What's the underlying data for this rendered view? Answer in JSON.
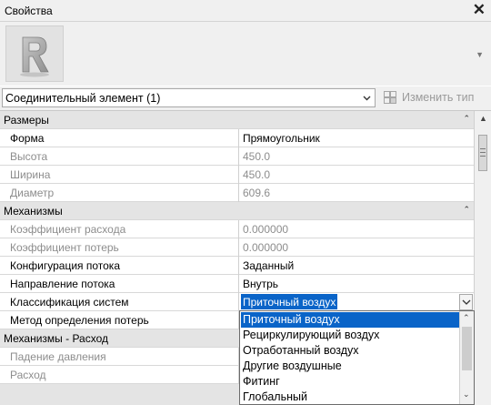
{
  "titlebar": {
    "title": "Свойства",
    "close_icon": "close-icon"
  },
  "preview": {
    "logo_letter": "R",
    "scroll_icon": "scroll-down-icon"
  },
  "type_selector": {
    "value": "Соединительный элемент (1)",
    "edit_type_label": "Изменить тип"
  },
  "groups": {
    "sizes": "Размеры",
    "mechanics": "Механизмы",
    "mechanics_flow": "Механизмы - Расход"
  },
  "params": {
    "shape": {
      "name": "Форма",
      "value": "Прямоугольник"
    },
    "height": {
      "name": "Высота",
      "value": "450.0"
    },
    "width": {
      "name": "Ширина",
      "value": "450.0"
    },
    "diameter": {
      "name": "Диаметр",
      "value": "609.6"
    },
    "flow_coef": {
      "name": "Коэффициент расхода",
      "value": "0.000000"
    },
    "loss_coef": {
      "name": "Коэффициент потерь",
      "value": "0.000000"
    },
    "flow_config": {
      "name": "Конфигурация потока",
      "value": "Заданный"
    },
    "flow_direction": {
      "name": "Направление потока",
      "value": "Внутрь"
    },
    "system_class": {
      "name": "Классификация систем",
      "value": "Приточный воздух"
    },
    "loss_method": {
      "name": "Метод определения потерь",
      "value": ""
    },
    "pressure_drop": {
      "name": "Падение давления",
      "value": ""
    },
    "flow": {
      "name": "Расход",
      "value": ""
    }
  },
  "dropdown": {
    "options": [
      "Приточный воздух",
      "Рециркулирующий воздух",
      "Отработанный воздух",
      "Другие воздушные",
      "Фитинг",
      "Глобальный"
    ],
    "selected_index": 0
  },
  "colors": {
    "selection": "#0a64c8",
    "group_bg": "#e4e4e4",
    "dim_text": "#8d8d8d"
  }
}
